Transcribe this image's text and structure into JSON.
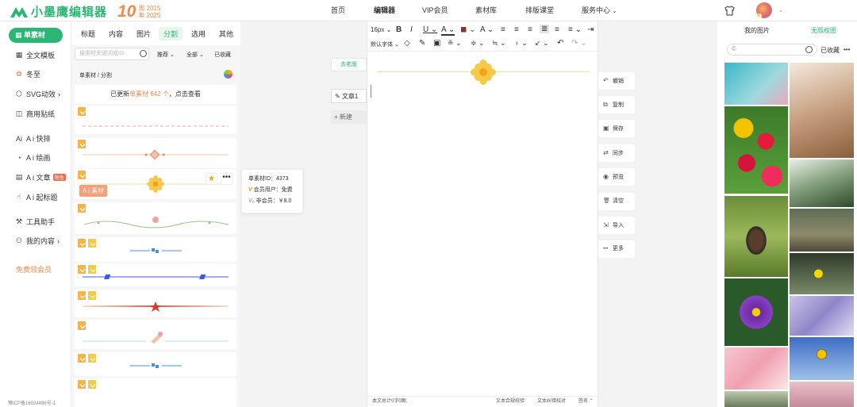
{
  "app": {
    "name": "小墨鹰编辑器",
    "anniv": "10",
    "anniv_line1": "周 2015",
    "anniv_line2": "年 2025"
  },
  "nav": [
    "首页",
    "编辑器",
    "VIP会员",
    "素材库",
    "排版课堂",
    "服务中心"
  ],
  "user": {
    "vip_badge": "V",
    "chev": "⌄"
  },
  "sidebar": {
    "active": "单素材",
    "items": [
      {
        "icon": "▦",
        "label": "全文模板"
      },
      {
        "icon": "✿",
        "label": "冬至"
      },
      {
        "icon": "⬡",
        "label": "SVG动效"
      },
      {
        "icon": "◫",
        "label": "商用贴纸"
      },
      {
        "icon": "Ai",
        "label": "A i 快排"
      },
      {
        "icon": "◔",
        "label": "A i 绘画"
      },
      {
        "icon": "▤",
        "label": "A i 文章",
        "hot": "限免"
      },
      {
        "icon": "☝",
        "label": "A i 起标题"
      },
      {
        "icon": "⚒",
        "label": "工具助手"
      },
      {
        "icon": "⚇",
        "label": "我的内容"
      }
    ],
    "arrow": "›",
    "vip": "免费领会员",
    "icp": "豫ICP备16024496号-1"
  },
  "panel": {
    "tabs": [
      "标题",
      "内容",
      "图片",
      "分割",
      "选用",
      "其他"
    ],
    "search_placeholder": "搜索材关键词或ID",
    "filters": [
      "推荐 ⌄",
      "全部 ⌄",
      "已收藏"
    ],
    "crumb": "单素材 / 分割",
    "notice_pre": "已更新",
    "notice_hl": "单素材 642 个",
    "notice_post": "，点击查看",
    "ai_badge": "A i 素材",
    "star": "★",
    "more": "•••"
  },
  "tooltip": {
    "id": "单素材ID：4373",
    "member": "会员用户：免费",
    "nonmember": "非会员：￥8.0",
    "v1": "V",
    "v0": "V₀"
  },
  "doc": {
    "old": "去老版",
    "doc1": "文章1",
    "new": "新建"
  },
  "toolbar": {
    "row1": [
      "16px ⌄",
      "B",
      "I",
      "U ⌄",
      "A ⌄",
      "◼ ⌄",
      "A ⌄",
      "≡",
      "≡",
      "≡",
      "≣",
      "≡",
      "≡ ⌄",
      "⇥"
    ],
    "row2": [
      "默认字体 ⌄",
      "◇",
      "✎",
      "▣",
      "≗ ⌄",
      "≑ ⌄",
      "≒ ⌄",
      "♁ ⌄",
      "↙ ⌄",
      "↶",
      "↷ ⌄"
    ]
  },
  "status": {
    "count": "本文总计0字0图;",
    "check1": "文本合规校验",
    "check2": "文本纠错校对",
    "sign": "签名 ⌃"
  },
  "actions": [
    {
      "icon": "↶",
      "label": "撤销"
    },
    {
      "icon": "⧉",
      "label": "复制"
    },
    {
      "icon": "▣",
      "label": "保存"
    },
    {
      "icon": "⇄",
      "label": "同步"
    },
    {
      "icon": "◉",
      "label": "预览"
    },
    {
      "icon": "🗑",
      "label": "清空"
    },
    {
      "icon": "⇲",
      "label": "导入"
    },
    {
      "icon": "•••",
      "label": "更多"
    }
  ],
  "right": {
    "tab1": "我的图片",
    "tab2": "无版权图",
    "collected": "已收藏",
    "more": "•••",
    "collapse": "‹"
  },
  "colors": {
    "brand": "#2bb673",
    "orange": "#f08a4b",
    "gold": "#f3b54a"
  }
}
